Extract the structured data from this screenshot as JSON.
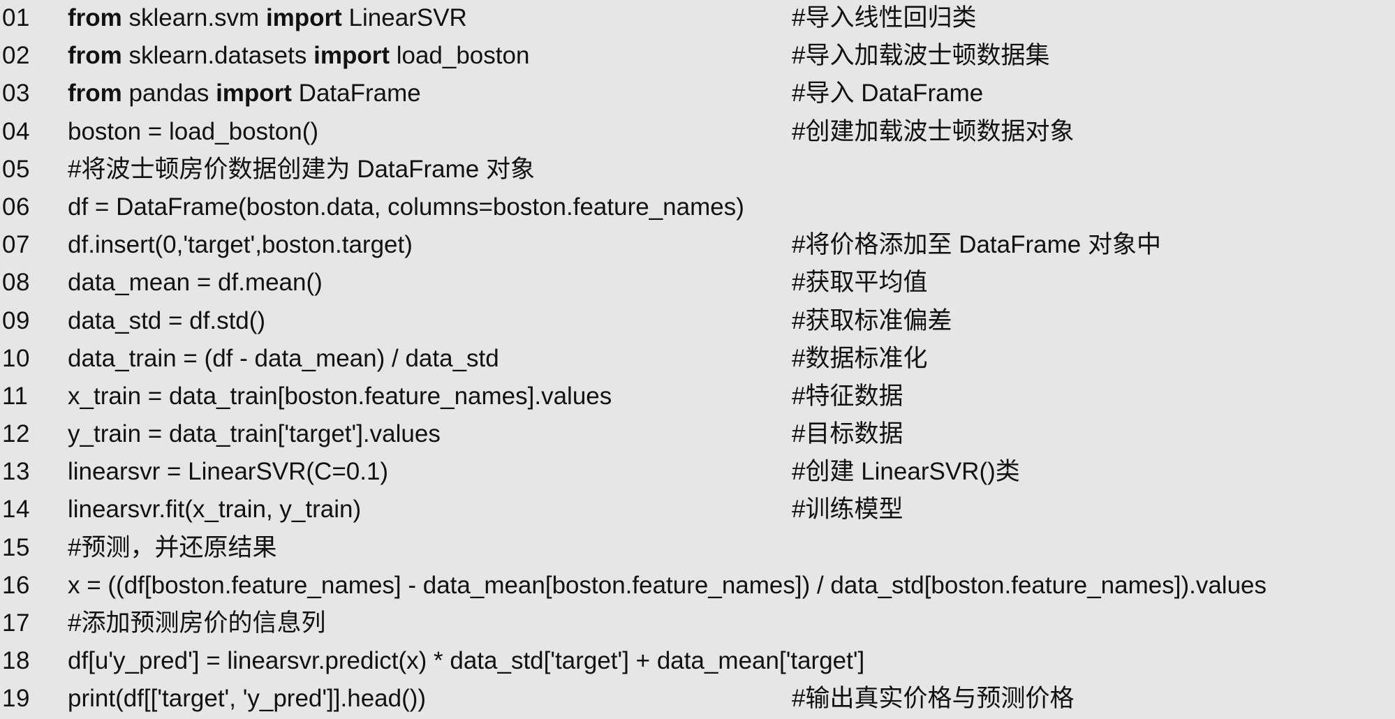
{
  "lines": [
    {
      "no": "01",
      "code": [
        {
          "t": "from",
          "kw": true
        },
        {
          "t": " sklearn.svm "
        },
        {
          "t": "import",
          "kw": true
        },
        {
          "t": " LinearSVR"
        }
      ],
      "comment": "#导入线性回归类"
    },
    {
      "no": "02",
      "code": [
        {
          "t": "from",
          "kw": true
        },
        {
          "t": " sklearn.datasets "
        },
        {
          "t": "import",
          "kw": true
        },
        {
          "t": " load_boston"
        }
      ],
      "comment": "#导入加载波士顿数据集"
    },
    {
      "no": "03",
      "code": [
        {
          "t": "from",
          "kw": true
        },
        {
          "t": " pandas "
        },
        {
          "t": "import",
          "kw": true
        },
        {
          "t": " DataFrame"
        }
      ],
      "comment": "#导入 DataFrame"
    },
    {
      "no": "04",
      "code": [
        {
          "t": "boston = load_boston()"
        }
      ],
      "comment": "#创建加载波士顿数据对象"
    },
    {
      "no": "05",
      "code": [
        {
          "t": "#将波士顿房价数据创建为 DataFrame 对象"
        }
      ],
      "comment": ""
    },
    {
      "no": "06",
      "code": [
        {
          "t": "df = DataFrame(boston.data, columns=boston.feature_names)"
        }
      ],
      "comment": ""
    },
    {
      "no": "07",
      "code": [
        {
          "t": "df.insert(0,'target',boston.target)"
        }
      ],
      "comment": "#将价格添加至 DataFrame 对象中"
    },
    {
      "no": "08",
      "code": [
        {
          "t": "data_mean = df.mean()"
        }
      ],
      "comment": "#获取平均值"
    },
    {
      "no": "09",
      "code": [
        {
          "t": "data_std = df.std()"
        }
      ],
      "comment": "#获取标准偏差"
    },
    {
      "no": "10",
      "code": [
        {
          "t": "data_train = (df - data_mean) / data_std"
        }
      ],
      "comment": "#数据标准化"
    },
    {
      "no": "11",
      "code": [
        {
          "t": "x_train = data_train[boston.feature_names].values"
        }
      ],
      "comment": "#特征数据"
    },
    {
      "no": "12",
      "code": [
        {
          "t": "y_train = data_train['target'].values"
        }
      ],
      "comment": "#目标数据"
    },
    {
      "no": "13",
      "code": [
        {
          "t": "linearsvr = LinearSVR(C=0.1)"
        }
      ],
      "comment": "#创建 LinearSVR()类"
    },
    {
      "no": "14",
      "code": [
        {
          "t": "linearsvr.fit(x_train, y_train)"
        }
      ],
      "comment": "#训练模型"
    },
    {
      "no": "15",
      "code": [
        {
          "t": "#预测，并还原结果"
        }
      ],
      "comment": ""
    },
    {
      "no": "16",
      "code": [
        {
          "t": "x = ((df[boston.feature_names] - data_mean[boston.feature_names]) / data_std[boston.feature_names]).values"
        }
      ],
      "comment": ""
    },
    {
      "no": "17",
      "code": [
        {
          "t": "#添加预测房价的信息列"
        }
      ],
      "comment": ""
    },
    {
      "no": "18",
      "code": [
        {
          "t": "df[u'y_pred'] = linearsvr.predict(x) * data_std['target'] + data_mean['target']"
        }
      ],
      "comment": ""
    },
    {
      "no": "19",
      "code": [
        {
          "t": "print(df[['target', 'y_pred']].head())"
        }
      ],
      "comment": "#输出真实价格与预测价格"
    }
  ]
}
